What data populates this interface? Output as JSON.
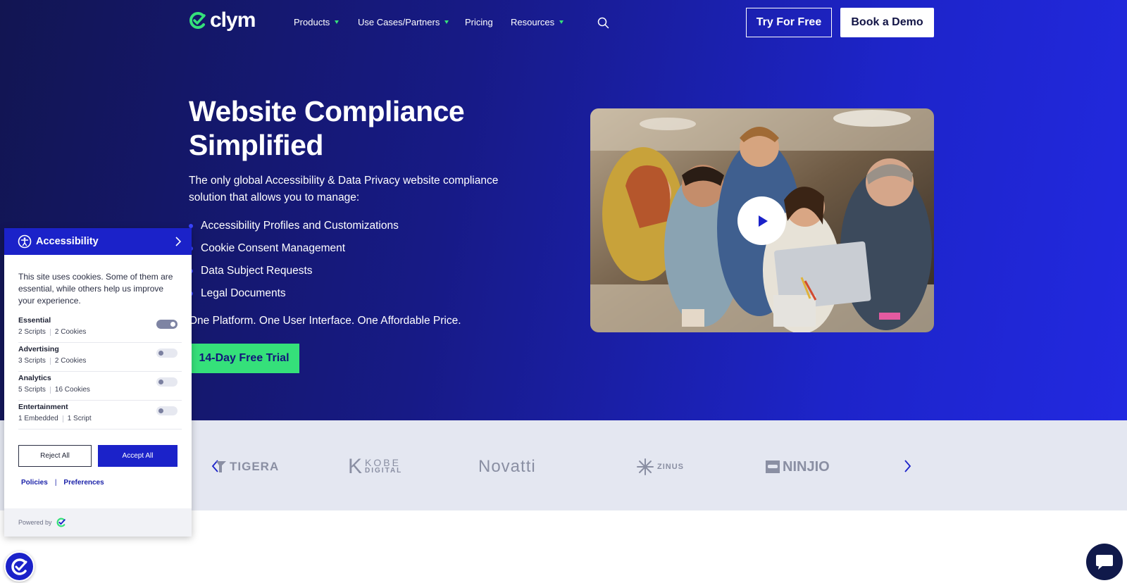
{
  "brand": {
    "name": "clym",
    "accent": "#35e07a",
    "primary": "#1b22c9"
  },
  "nav": {
    "items": [
      {
        "label": "Products",
        "has_dropdown": true
      },
      {
        "label": "Use Cases/Partners",
        "has_dropdown": true
      },
      {
        "label": "Pricing",
        "has_dropdown": false
      },
      {
        "label": "Resources",
        "has_dropdown": true
      }
    ],
    "search_icon": "search-icon",
    "try_label": "Try For Free",
    "demo_label": "Book a Demo"
  },
  "hero": {
    "title": "Website Compliance Simplified",
    "intro": "The only global Accessibility & Data Privacy website compliance solution that allows you to manage:",
    "features": [
      "Accessibility Profiles and Customizations",
      "Cookie Consent Management",
      "Data Subject Requests",
      "Legal Documents"
    ],
    "tagline": "One Platform. One User Interface. One Affordable Price.",
    "cta_label": "14-Day Free Trial",
    "video_icon": "play-icon"
  },
  "clients": {
    "logos": [
      "TIGERA",
      "KOBE",
      "DIGITAL",
      "Novatti",
      "ZINUS",
      "NINJIO"
    ]
  },
  "consent": {
    "header": "Accessibility",
    "text": "This site uses cookies. Some of them are essential, while others help us improve your experience.",
    "categories": [
      {
        "name": "Essential",
        "scripts": "2 Scripts",
        "cookies": "2 Cookies",
        "enabled": true
      },
      {
        "name": "Advertising",
        "scripts": "3 Scripts",
        "cookies": "2 Cookies",
        "enabled": false
      },
      {
        "name": "Analytics",
        "scripts": "5 Scripts",
        "cookies": "16 Cookies",
        "enabled": false
      },
      {
        "name": "Entertainment",
        "scripts": "1 Embedded",
        "cookies": "1 Script",
        "enabled": false
      }
    ],
    "reject_label": "Reject All",
    "accept_label": "Accept All",
    "policies_label": "Policies",
    "divider": "|",
    "preferences_label": "Preferences",
    "powered_by": "Powered by"
  }
}
